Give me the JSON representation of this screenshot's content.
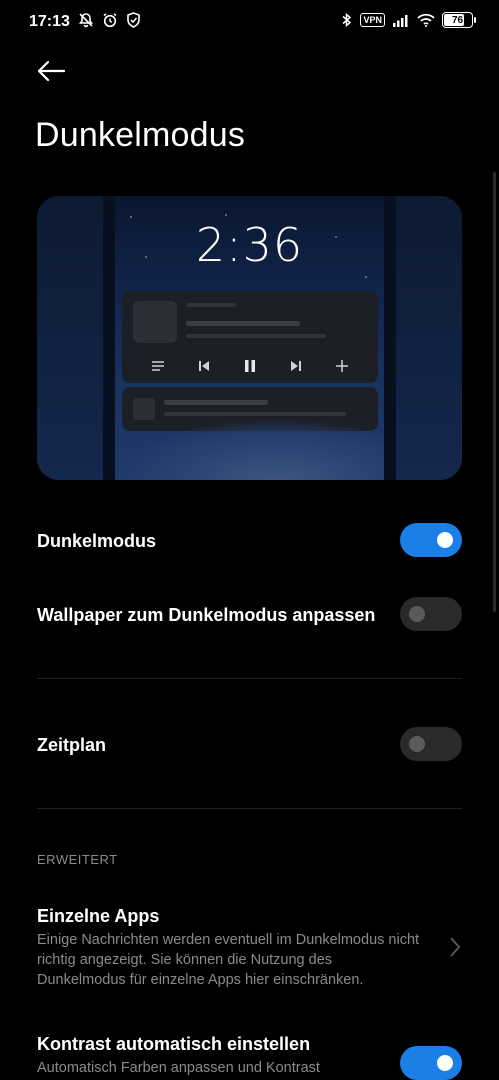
{
  "status_bar": {
    "time": "17:13",
    "vpn": "VPN",
    "battery": "76",
    "battery_level_percent": 76,
    "left_icons": [
      "notifications-off-icon",
      "alarm-icon",
      "shield-icon"
    ],
    "right_icons": [
      "bluetooth-icon",
      "vpn-icon",
      "signal-icon",
      "wifi-icon",
      "battery-icon"
    ]
  },
  "header": {
    "title": "Dunkelmodus",
    "back_icon": "back-arrow-icon"
  },
  "preview": {
    "clock": "2:36",
    "media_icons": [
      "list-icon",
      "previous-icon",
      "pause-icon",
      "next-icon",
      "plus-icon"
    ]
  },
  "settings": {
    "dark_mode": {
      "label": "Dunkelmodus",
      "enabled": true
    },
    "wallpaper": {
      "label": "Wallpaper zum Dunkelmodus anpassen",
      "enabled": false
    },
    "schedule": {
      "label": "Zeitplan",
      "enabled": false
    },
    "section_advanced": "ERWEITERT",
    "individual_apps": {
      "label": "Einzelne Apps",
      "description": "Einige Nachrichten werden eventuell im Dunkelmodus nicht richtig angezeigt. Sie können die Nutzung des Dunkelmodus für einzelne Apps hier einschränken."
    },
    "auto_contrast": {
      "label": "Kontrast automatisch einstellen",
      "description": "Automatisch Farben anpassen und Kontrast",
      "enabled": true
    }
  },
  "colors": {
    "background": "#000000",
    "toggle_on": "#1a7fe6",
    "toggle_off": "#2a2a2a",
    "secondary_text": "#8a8a8a"
  }
}
